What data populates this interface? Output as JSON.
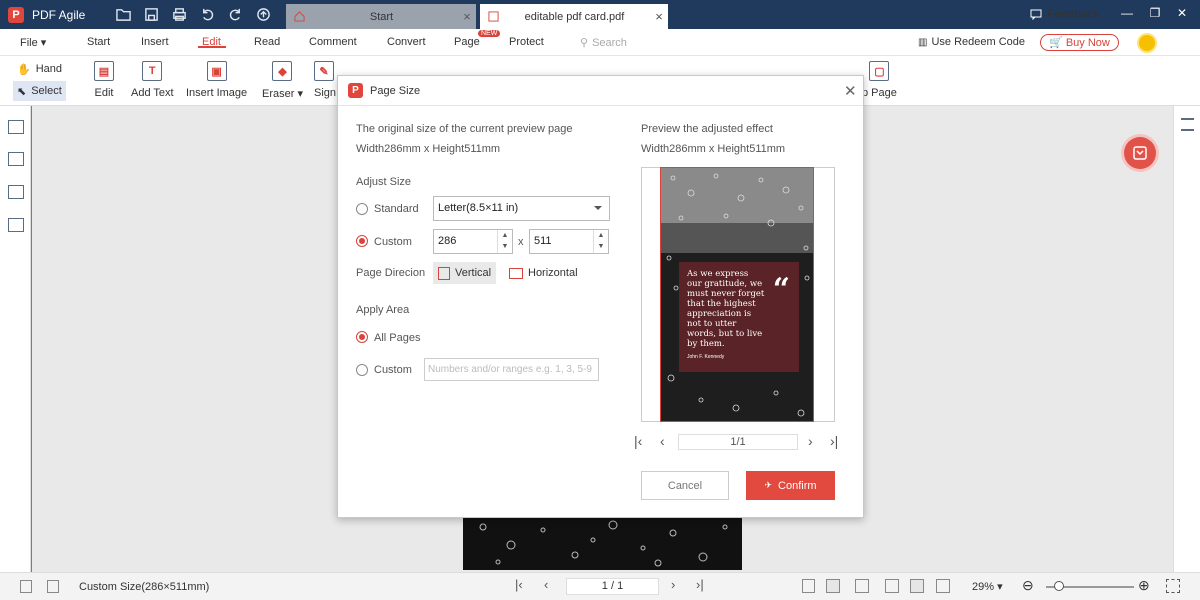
{
  "app": {
    "name": "PDF Agile",
    "logo_letter": "P"
  },
  "tabs": [
    {
      "label": "Start"
    },
    {
      "label": "editable pdf card.pdf"
    }
  ],
  "titlebar": {
    "feedback": "Feedback"
  },
  "menu": {
    "file": "File",
    "items": [
      "Start",
      "Insert",
      "Edit",
      "Read",
      "Comment",
      "Convert",
      "Page",
      "Protect"
    ],
    "active": "Edit",
    "new_badge": "NEW",
    "search_placeholder": "Search",
    "redeem": "Use Redeem Code",
    "buy_now": "Buy Now"
  },
  "toolbar": {
    "hand": "Hand",
    "select": "Select",
    "tools": [
      "Edit",
      "Add Text",
      "Insert Image",
      "Eraser",
      "Signa",
      "p Page"
    ]
  },
  "status": {
    "page_size": "Custom Size(286×511mm)",
    "page_indicator": "1 / 1",
    "zoom": "29%"
  },
  "dialog": {
    "title": "Page Size",
    "original_label": "The original size of the current preview page",
    "original_size": "Width286mm x Height511mm",
    "adjust_label": "Adjust Size",
    "standard_label": "Standard",
    "standard_value": "Letter(8.5×11 in)",
    "custom_label": "Custom",
    "width_value": "286",
    "times": "x",
    "height_value": "511",
    "direction_label": "Page Direcion",
    "vertical": "Vertical",
    "horizontal": "Horizontal",
    "apply_label": "Apply Area",
    "all_pages": "All Pages",
    "custom_area": "Custom",
    "range_placeholder": "Numbers and/or ranges e.g. 1, 3, 5-9",
    "preview_label": "Preview the adjusted effect",
    "preview_size": "Width286mm x Height511mm",
    "preview_page": "1/1",
    "quote": "As we express our gratitude, we must never forget that the highest appreciation is not to utter words, but to live by them.",
    "quote_author": "John F. Kennedy",
    "quote_mark": "“",
    "cancel": "Cancel",
    "confirm": "Confirm"
  },
  "colors": {
    "accent": "#d9433a",
    "titlebar": "#1f3a5c",
    "quote_bg": "#5a2327"
  }
}
